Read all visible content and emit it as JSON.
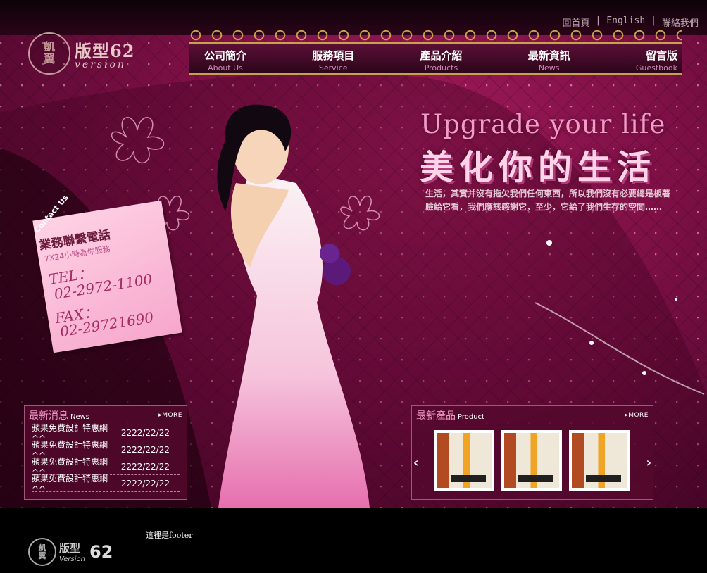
{
  "logo": {
    "seal": "凱\n翼",
    "title": "版型62",
    "subtitle": "version"
  },
  "top_links": [
    "回首頁",
    "English",
    "聯絡我們"
  ],
  "nav": [
    {
      "zh": "公司簡介",
      "en": "About Us"
    },
    {
      "zh": "服務項目",
      "en": "Service"
    },
    {
      "zh": "產品介紹",
      "en": "Products"
    },
    {
      "zh": "最新資訊",
      "en": "News"
    },
    {
      "zh": "留言版",
      "en": "Guestbook"
    }
  ],
  "hero": {
    "headline": "Upgrade your life",
    "headline_zh": "美化你的生活",
    "description": "生活，其實并沒有拖欠我們任何東西，所以我們沒有必要總是板著臉給它看，我們應該感謝它，至少，它給了我們生存的空間……"
  },
  "contact": {
    "tab": "Contact Us",
    "title": "業務聯繫電話",
    "subtitle": "7X24小時為你服務",
    "tel_label": "TEL：",
    "tel": "02-2972-1100",
    "fax_label": "FAX：",
    "fax": "02-29721690"
  },
  "news": {
    "title": "最新消息",
    "title_en": "News",
    "more": "MORE",
    "items": [
      {
        "title": "蘋果免費設計特惠網^^",
        "date": "2222/22/22"
      },
      {
        "title": "蘋果免費設計特惠網^^",
        "date": "2222/22/22"
      },
      {
        "title": "蘋果免費設計特惠網^^",
        "date": "2222/22/22"
      },
      {
        "title": "蘋果免費設計特惠網^^",
        "date": "2222/22/22"
      }
    ]
  },
  "products": {
    "title": "最新產品",
    "title_en": "Product",
    "more": "MORE",
    "prev": "‹",
    "next": "›",
    "thumbnails": 3
  },
  "footer": {
    "seal": "凱\n翼",
    "brand": "版型",
    "brand_en": "Version",
    "number": "62",
    "text": "這裡是footer"
  }
}
